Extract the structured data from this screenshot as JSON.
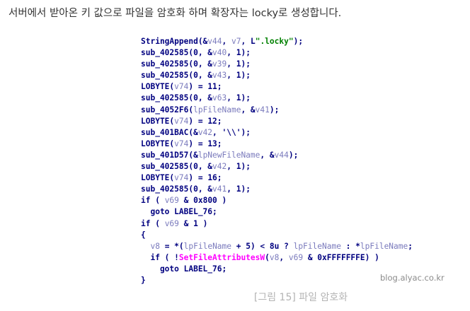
{
  "intro_text": "서버에서 받아온 키 값으로 파일을 암호화 하며 확장자는 locky로 생성합니다.",
  "code_lines": [
    [
      {
        "t": "StringAppend(&"
      },
      {
        "t": "v44",
        "c": "var"
      },
      {
        "t": ", "
      },
      {
        "t": "v7",
        "c": "var"
      },
      {
        "t": ", L"
      },
      {
        "t": "\".locky\"",
        "c": "str"
      },
      {
        "t": ");"
      }
    ],
    [
      {
        "t": "sub_402585(0, &"
      },
      {
        "t": "v40",
        "c": "var"
      },
      {
        "t": ", 1);"
      }
    ],
    [
      {
        "t": "sub_402585(0, &"
      },
      {
        "t": "v39",
        "c": "var"
      },
      {
        "t": ", 1);"
      }
    ],
    [
      {
        "t": "sub_402585(0, &"
      },
      {
        "t": "v43",
        "c": "var"
      },
      {
        "t": ", 1);"
      }
    ],
    [
      {
        "t": "LOBYTE("
      },
      {
        "t": "v74",
        "c": "var"
      },
      {
        "t": ") = 11;"
      }
    ],
    [
      {
        "t": "sub_402585(0, &"
      },
      {
        "t": "v63",
        "c": "var"
      },
      {
        "t": ", 1);"
      }
    ],
    [
      {
        "t": "sub_4052F6("
      },
      {
        "t": "lpFileName",
        "c": "var"
      },
      {
        "t": ", &"
      },
      {
        "t": "v41",
        "c": "var"
      },
      {
        "t": ");"
      }
    ],
    [
      {
        "t": "LOBYTE("
      },
      {
        "t": "v74",
        "c": "var"
      },
      {
        "t": ") = 12;"
      }
    ],
    [
      {
        "t": "sub_401BAC(&"
      },
      {
        "t": "v42",
        "c": "var"
      },
      {
        "t": ", '\\\\');"
      }
    ],
    [
      {
        "t": "LOBYTE("
      },
      {
        "t": "v74",
        "c": "var"
      },
      {
        "t": ") = 13;"
      }
    ],
    [
      {
        "t": "sub_401D57(&"
      },
      {
        "t": "lpNewFileName",
        "c": "var"
      },
      {
        "t": ", &"
      },
      {
        "t": "v44",
        "c": "var"
      },
      {
        "t": ");"
      }
    ],
    [
      {
        "t": "sub_402585(0, &"
      },
      {
        "t": "v42",
        "c": "var"
      },
      {
        "t": ", 1);"
      }
    ],
    [
      {
        "t": "LOBYTE("
      },
      {
        "t": "v74",
        "c": "var"
      },
      {
        "t": ") = 16;"
      }
    ],
    [
      {
        "t": "sub_402585(0, &"
      },
      {
        "t": "v41",
        "c": "var"
      },
      {
        "t": ", 1);"
      }
    ],
    [
      {
        "t": "if ( "
      },
      {
        "t": "v69",
        "c": "var"
      },
      {
        "t": " & 0x800 )"
      }
    ],
    [
      {
        "t": "  goto LABEL_76;"
      }
    ],
    [
      {
        "t": "if ( "
      },
      {
        "t": "v69",
        "c": "var"
      },
      {
        "t": " & 1 )"
      }
    ],
    [
      {
        "t": "{"
      }
    ],
    [
      {
        "t": "  "
      },
      {
        "t": "v8",
        "c": "var"
      },
      {
        "t": " = *("
      },
      {
        "t": "lpFileName",
        "c": "var"
      },
      {
        "t": " + 5) < 8u ? "
      },
      {
        "t": "lpFileName",
        "c": "var"
      },
      {
        "t": " : *"
      },
      {
        "t": "lpFileName",
        "c": "var"
      },
      {
        "t": ";"
      }
    ],
    [
      {
        "t": "  if ( !"
      },
      {
        "t": "SetFileAttributesW",
        "c": "imp"
      },
      {
        "t": "("
      },
      {
        "t": "v8",
        "c": "var"
      },
      {
        "t": ", "
      },
      {
        "t": "v69",
        "c": "var"
      },
      {
        "t": " & 0xFFFFFFFE) )"
      }
    ],
    [
      {
        "t": "    goto LABEL_76;"
      }
    ],
    [
      {
        "t": "}"
      }
    ]
  ],
  "watermark": "blog.alyac.co.kr",
  "caption": "[그림 15] 파일 암호화",
  "colors": {
    "code_default": "#000080",
    "code_var": "#7b7bbd",
    "code_string": "#008000",
    "code_import": "#ff00ff"
  }
}
